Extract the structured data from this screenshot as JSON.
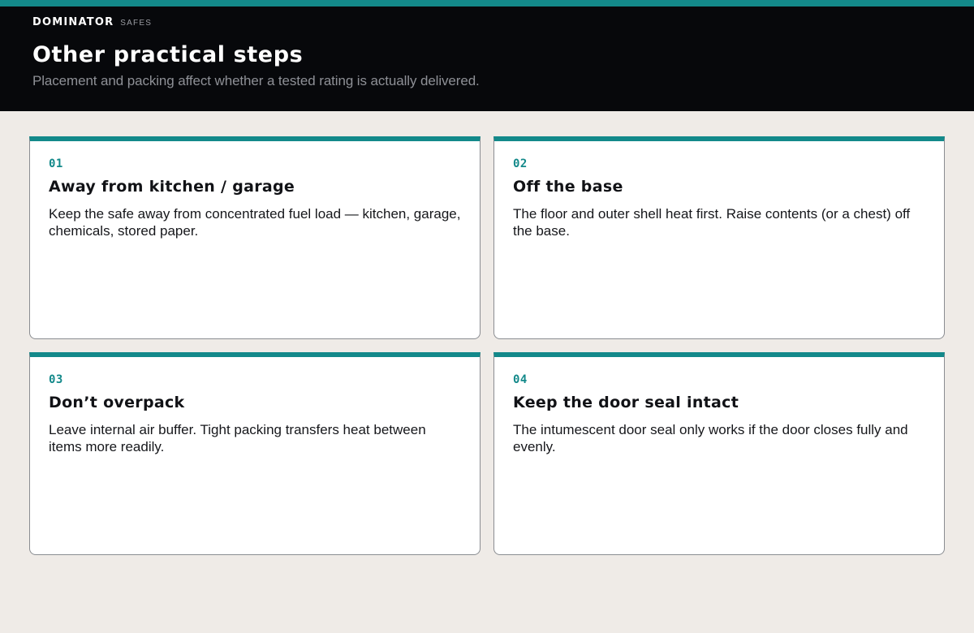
{
  "brand": {
    "name": "DOMINATOR",
    "sub": "SAFES"
  },
  "header": {
    "title": "Other practical steps",
    "subtitle": "Placement and packing affect whether a tested rating is actually delivered."
  },
  "colors": {
    "accent": "#13898a",
    "header_bg": "#07080b",
    "page_bg": "#efebe7"
  },
  "cards": [
    {
      "number": "01",
      "title": "Away from kitchen / garage",
      "body": "Keep the safe away from concentrated fuel load — kitchen, garage, chemicals, stored paper."
    },
    {
      "number": "02",
      "title": "Off the base",
      "body": "The floor and outer shell heat first. Raise contents (or a chest) off the base."
    },
    {
      "number": "03",
      "title": "Don’t overpack",
      "body": "Leave internal air buffer. Tight packing transfers heat between items more readily."
    },
    {
      "number": "04",
      "title": "Keep the door seal intact",
      "body": "The intumescent door seal only works if the door closes fully and evenly."
    }
  ]
}
